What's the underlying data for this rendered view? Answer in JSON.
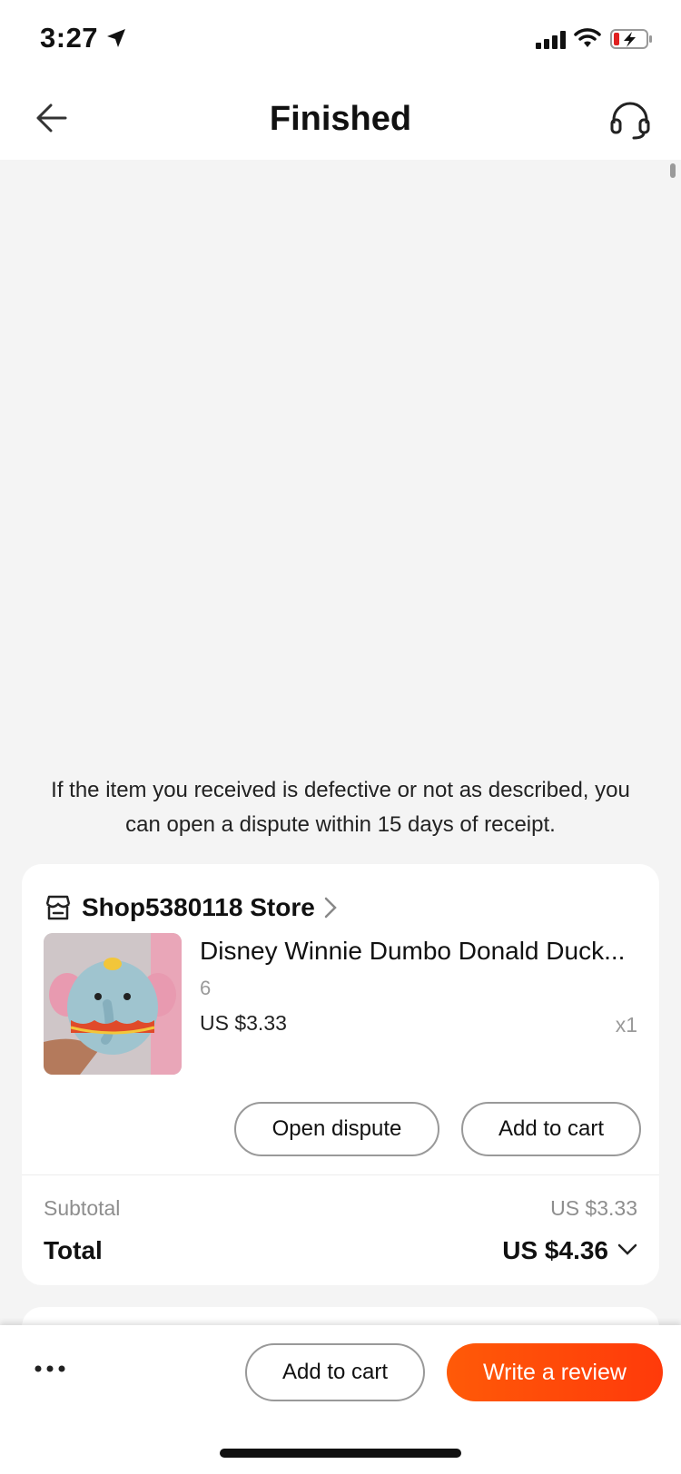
{
  "status_bar": {
    "time": "3:27"
  },
  "nav": {
    "title": "Finished"
  },
  "notice": "If the item you received is defective or not as described, you can open a dispute within 15 days of receipt.",
  "order": {
    "store_name": "Shop5380118 Store",
    "product": {
      "title": "Disney Winnie Dumbo Donald Duck...",
      "variant": "6",
      "price": "US $3.33",
      "quantity": "x1"
    },
    "buttons": {
      "open_dispute": "Open dispute",
      "add_to_cart": "Add to cart"
    },
    "summary": {
      "subtotal_label": "Subtotal",
      "subtotal_value": "US $3.33",
      "total_label": "Total",
      "total_value": "US $4.36"
    }
  },
  "bottom_bar": {
    "add_to_cart": "Add to cart",
    "write_review": "Write a review"
  },
  "colors": {
    "accent": "#ff4c0a",
    "background": "#f4f4f4",
    "battery_low": "#e02020"
  },
  "icons": [
    "location-arrow-icon",
    "signal-icon",
    "wifi-icon",
    "battery-icon",
    "back-arrow-icon",
    "headset-icon",
    "store-icon",
    "chevron-right-icon",
    "chevron-down-icon",
    "more-icon"
  ]
}
